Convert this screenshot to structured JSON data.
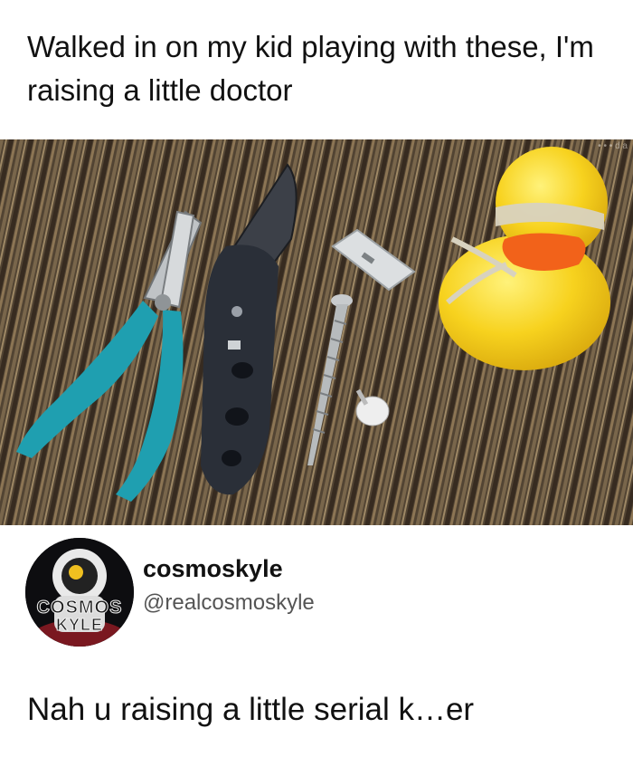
{
  "post": {
    "caption": "Walked in on my kid playing with these, I'm raising a little doctor"
  },
  "photo": {
    "description_icon": "photo-tools-and-duck",
    "watermark": "• • • d a"
  },
  "tweet": {
    "avatar_text_line1": "COSMOS",
    "avatar_text_line2": "KYLE",
    "username": "cosmoskyle",
    "handle": "@realcosmoskyle",
    "text": "Nah u raising a little serial k…er"
  },
  "colors": {
    "background": "#ffffff",
    "plier_handle": "#1f9fb0",
    "duck_yellow": "#f7d21e",
    "duck_beak": "#f2621a",
    "knife_handle": "#2a2f38"
  }
}
